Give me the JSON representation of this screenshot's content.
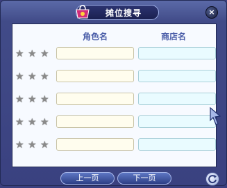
{
  "dialog": {
    "title": "摊位搜寻",
    "close_glyph": "×"
  },
  "columns": {
    "role_name": "角色名",
    "shop_name": "商店名"
  },
  "rows": [
    {
      "stars": [
        "star-icon",
        "star-icon",
        "star-icon"
      ],
      "role_value": "",
      "shop_value": ""
    },
    {
      "stars": [
        "star-icon",
        "star-icon",
        "star-icon"
      ],
      "role_value": "",
      "shop_value": ""
    },
    {
      "stars": [
        "star-icon",
        "star-icon",
        "star-icon"
      ],
      "role_value": "",
      "shop_value": ""
    },
    {
      "stars": [
        "star-icon",
        "star-icon",
        "star-icon"
      ],
      "role_value": "",
      "shop_value": ""
    },
    {
      "stars": [
        "star-icon",
        "star-icon",
        "star-icon"
      ],
      "role_value": "",
      "shop_value": ""
    }
  ],
  "footer": {
    "prev_label": "上一页",
    "next_label": "下一页"
  },
  "colors": {
    "panel_bg": "#f7faff",
    "header_text": "#4a5da8",
    "role_field": "#fffdee",
    "shop_field": "#e9fbff",
    "window_bg": "#414b88"
  }
}
